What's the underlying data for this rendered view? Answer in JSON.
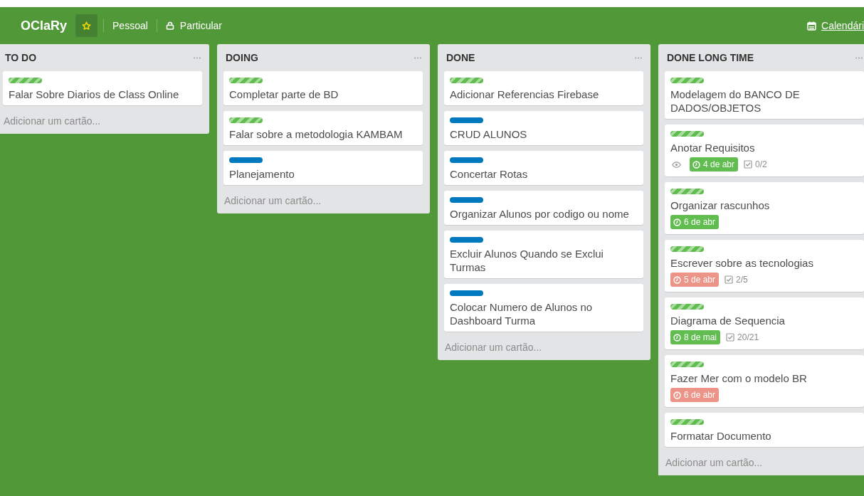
{
  "header": {
    "board_name": "OClaRy",
    "starred": true,
    "team": "Pessoal",
    "visibility": "Particular",
    "calendar_link": "Calendári"
  },
  "lists": [
    {
      "title": "TO DO",
      "add_card": "Adicionar um cartão...",
      "cards": [
        {
          "labels": [
            {
              "kind": "green"
            }
          ],
          "title": "Falar Sobre Diarios de Class Online"
        }
      ]
    },
    {
      "title": "DOING",
      "add_card": "Adicionar um cartão...",
      "cards": [
        {
          "labels": [
            {
              "kind": "green"
            }
          ],
          "title": "Completar parte de BD"
        },
        {
          "labels": [
            {
              "kind": "green"
            }
          ],
          "title": "Falar sobre a metodologia KAMBAM"
        },
        {
          "labels": [
            {
              "kind": "blue"
            }
          ],
          "title": "Planejamento"
        }
      ]
    },
    {
      "title": "DONE",
      "add_card": "Adicionar um cartão...",
      "cards": [
        {
          "labels": [
            {
              "kind": "green"
            }
          ],
          "title": "Adicionar Referencias Firebase"
        },
        {
          "labels": [
            {
              "kind": "blue"
            }
          ],
          "title": "CRUD ALUNOS"
        },
        {
          "labels": [
            {
              "kind": "blue"
            }
          ],
          "title": "Concertar Rotas"
        },
        {
          "labels": [
            {
              "kind": "blue"
            }
          ],
          "title": "Organizar Alunos por codigo ou nome"
        },
        {
          "labels": [
            {
              "kind": "blue"
            }
          ],
          "title": "Excluir Alunos Quando se Exclui Turmas"
        },
        {
          "labels": [
            {
              "kind": "blue"
            }
          ],
          "title": "Colocar Numero de Alunos no Dashboard Turma"
        }
      ]
    },
    {
      "title": "DONE LONG TIME",
      "add_card": "Adicionar um cartão...",
      "cards": [
        {
          "labels": [
            {
              "kind": "green"
            }
          ],
          "title": "Modelagem do BANCO DE DADOS/OBJETOS"
        },
        {
          "labels": [
            {
              "kind": "green"
            }
          ],
          "title": "Anotar Requisitos",
          "watching": true,
          "due": {
            "text": "4 de abr",
            "overdue": false
          },
          "checklist": "0/2"
        },
        {
          "labels": [
            {
              "kind": "green"
            }
          ],
          "title": "Organizar rascunhos",
          "due": {
            "text": "6 de abr",
            "overdue": false
          }
        },
        {
          "labels": [
            {
              "kind": "green"
            }
          ],
          "title": "Escrever sobre as tecnologias",
          "due": {
            "text": "5 de abr",
            "overdue": true
          },
          "checklist": "2/5"
        },
        {
          "labels": [
            {
              "kind": "green"
            }
          ],
          "title": "Diagrama de Sequencia",
          "due": {
            "text": "8 de mai",
            "overdue": false
          },
          "checklist": "20/21"
        },
        {
          "labels": [
            {
              "kind": "green"
            }
          ],
          "title": "Fazer Mer com o modelo BR",
          "due": {
            "text": "6 de abr",
            "overdue": true
          }
        },
        {
          "labels": [
            {
              "kind": "green"
            }
          ],
          "title": "Formatar Documento"
        }
      ]
    }
  ]
}
